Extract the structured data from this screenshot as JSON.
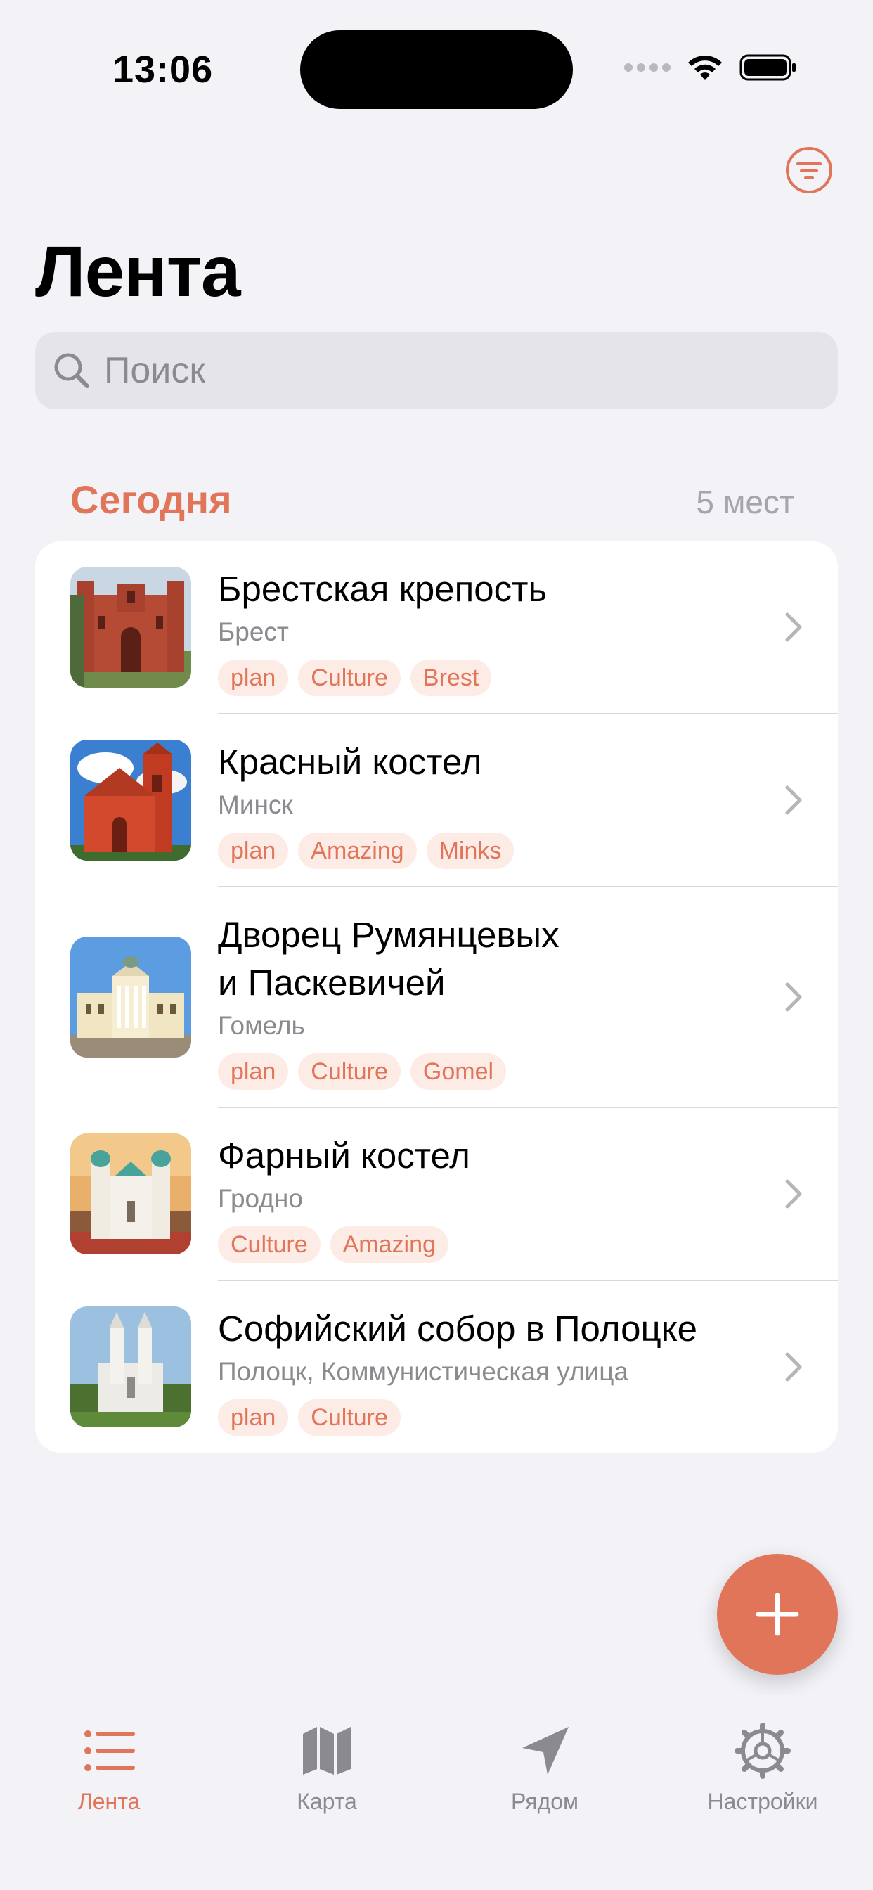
{
  "status_bar": {
    "time": "13:06"
  },
  "header": {
    "title": "Лента"
  },
  "search": {
    "placeholder": "Поиск"
  },
  "section": {
    "title": "Сегодня",
    "count": "5 мест"
  },
  "places": [
    {
      "title": "Брестская крепость",
      "subtitle": "Брест",
      "tags": [
        "plan",
        "Culture",
        "Brest"
      ],
      "thumb": "brest-fortress"
    },
    {
      "title": "Красный костел",
      "subtitle": "Минск",
      "tags": [
        "plan",
        "Amazing",
        "Minks"
      ],
      "thumb": "red-church"
    },
    {
      "title": "Дворец Румянцевых\nи Паскевичей",
      "subtitle": "Гомель",
      "tags": [
        "plan",
        "Culture",
        "Gomel"
      ],
      "thumb": "palace"
    },
    {
      "title": "Фарный костел",
      "subtitle": "Гродно",
      "tags": [
        "Culture",
        "Amazing"
      ],
      "thumb": "farny-church"
    },
    {
      "title": "Софийский собор в Полоцке",
      "subtitle": "Полоцк, Коммунистическая улица",
      "tags": [
        "plan",
        "Culture"
      ],
      "thumb": "sofia-cathedral"
    }
  ],
  "fab": {
    "icon": "plus-icon"
  },
  "tabs": [
    {
      "label": "Лента",
      "icon": "list-icon",
      "active": true
    },
    {
      "label": "Карта",
      "icon": "map-icon",
      "active": false
    },
    {
      "label": "Рядом",
      "icon": "location-arrow-icon",
      "active": false
    },
    {
      "label": "Настройки",
      "icon": "gear-icon",
      "active": false
    }
  ],
  "colors": {
    "accent": "#e0755a",
    "tag_bg": "#fdebe5",
    "background": "#f2f2f7"
  }
}
